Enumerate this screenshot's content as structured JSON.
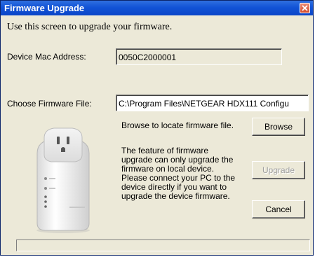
{
  "window": {
    "title": "Firmware Upgrade",
    "close_icon": "close-icon"
  },
  "instruction": "Use this screen to upgrade your firmware.",
  "mac": {
    "label": "Device Mac Address:",
    "value": "0050C2000001"
  },
  "firmware": {
    "label": "Choose Firmware File:",
    "value": "C:\\Program Files\\NETGEAR HDX111 Configu"
  },
  "browse": {
    "hint": "Browse to locate firmware file.",
    "button_label": "Browse"
  },
  "note": {
    "lines": [
      "The feature of firmware",
      "upgrade can only upgrade the",
      "firmware on local device.",
      "Please connect your PC to the",
      "device directly if you want to",
      "upgrade the device firmware."
    ]
  },
  "upgrade_button": {
    "label": "Upgrade",
    "enabled": false
  },
  "cancel_button": {
    "label": "Cancel"
  },
  "device_image": {
    "icon": "powerline-adapter-image"
  },
  "colors": {
    "titlebar": "#0a45c8",
    "window_bg": "#ece9d8",
    "close_button": "#d34c2e"
  }
}
